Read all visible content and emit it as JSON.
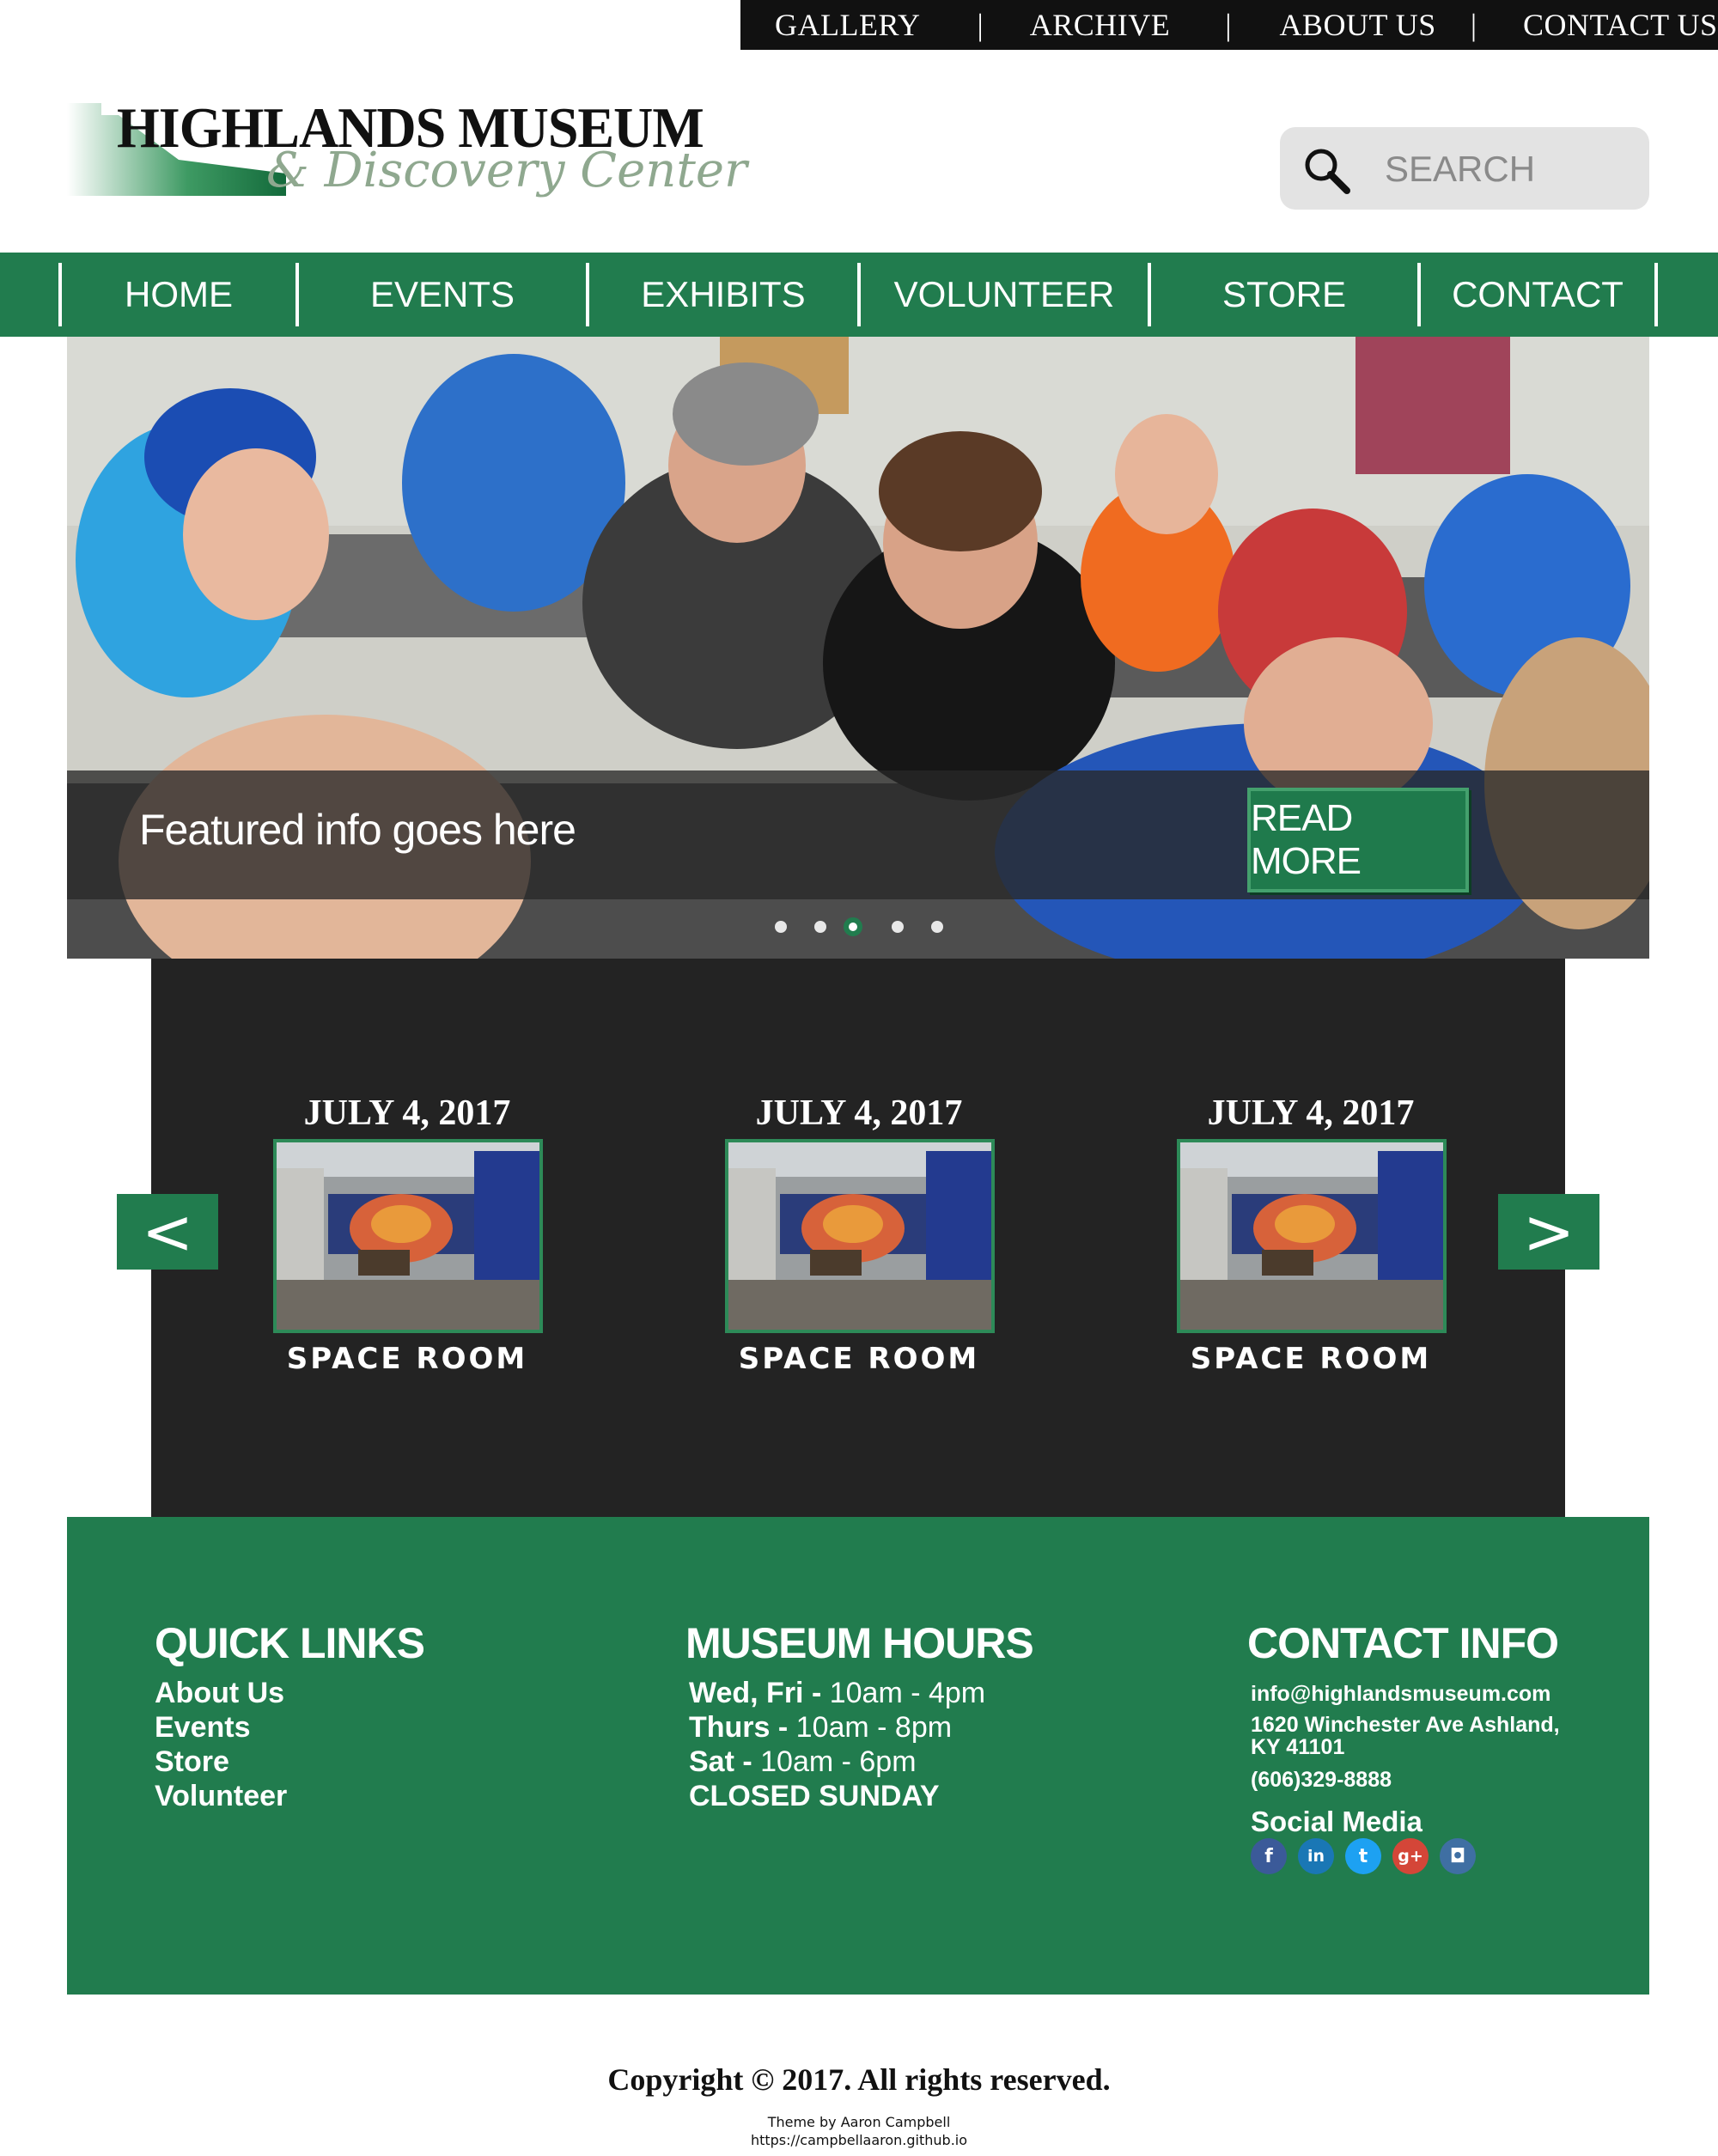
{
  "topnav": {
    "links": [
      "GALLERY",
      "ARCHIVE",
      "ABOUT US",
      "CONTACT US"
    ],
    "separator": "|"
  },
  "logo": {
    "title": "HIGHLANDS MUSEUM",
    "subtitle": "& Discovery Center"
  },
  "search": {
    "placeholder": "SEARCH",
    "icon": "search-icon"
  },
  "mainnav": {
    "items": [
      "HOME",
      "EVENTS",
      "EXHIBITS",
      "VOLUNTEER",
      "STORE",
      "CONTACT"
    ]
  },
  "hero": {
    "featured_text": "Featured info goes here",
    "read_more": "READ MORE",
    "slide_count": 5,
    "active_slide": 3
  },
  "events": {
    "prev_label": "<",
    "next_label": ">",
    "cards": [
      {
        "date": "JULY 4, 2017",
        "name": "SPACE ROOM"
      },
      {
        "date": "JULY 4, 2017",
        "name": "SPACE ROOM"
      },
      {
        "date": "JULY 4, 2017",
        "name": "SPACE ROOM"
      }
    ]
  },
  "footer": {
    "quick_links": {
      "heading": "QUICK LINKS",
      "links": [
        "About Us",
        "Events",
        "Store",
        "Volunteer"
      ]
    },
    "hours": {
      "heading": "MUSEUM HOURS",
      "rows": [
        {
          "days": "Wed, Fri -",
          "time": " 10am - 4pm"
        },
        {
          "days": "Thurs -",
          "time": " 10am - 8pm"
        },
        {
          "days": "Sat -",
          "time": " 10am - 6pm"
        }
      ],
      "closed": "CLOSED SUNDAY"
    },
    "contact": {
      "heading": "CONTACT INFO",
      "email": "info@highlandsmuseum.com",
      "address_line1": "1620 Winchester Ave Ashland,",
      "address_line2": "KY 41101",
      "phone": "(606)329-8888",
      "social_heading": "Social Media",
      "social": [
        {
          "icon": "facebook-icon",
          "glyph": "f",
          "color": "#3b5a99"
        },
        {
          "icon": "linkedin-icon",
          "glyph": "in",
          "color": "#1a77b5"
        },
        {
          "icon": "twitter-icon",
          "glyph": "t",
          "color": "#1da1f2"
        },
        {
          "icon": "google-plus-icon",
          "glyph": "g+",
          "color": "#d44638"
        },
        {
          "icon": "instagram-icon",
          "glyph": "◘",
          "color": "#3f6fa3"
        }
      ]
    }
  },
  "copyright": "Copyright © 2017. All rights reserved.",
  "theme_credit": {
    "line1": "Theme by Aaron Campbell",
    "line2": "https://campbellaaron.github.io"
  },
  "colors": {
    "brand_green": "#217c4e",
    "dark_panel": "#232323",
    "top_bar": "#111111"
  }
}
